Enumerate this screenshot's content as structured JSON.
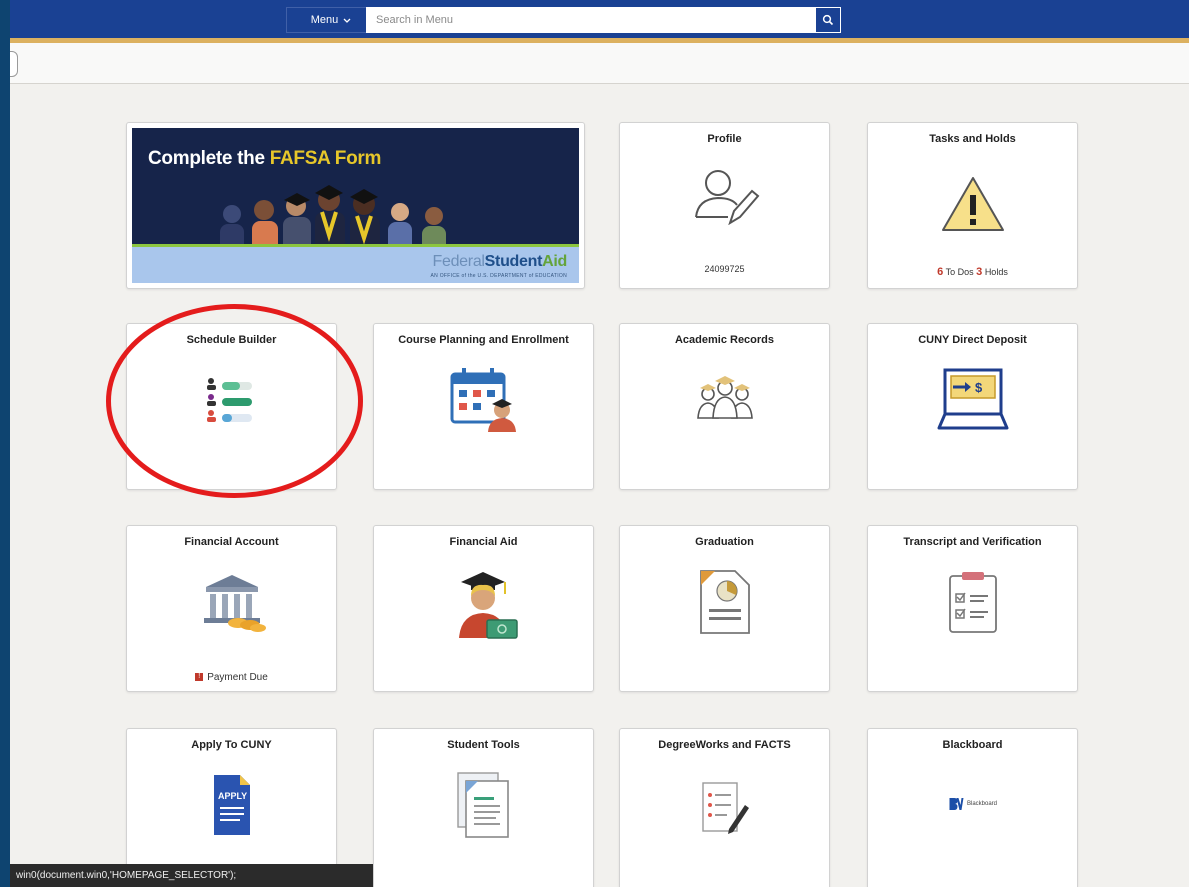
{
  "header": {
    "menu_label": "Menu",
    "search": {
      "placeholder": "Search in Menu",
      "value": ""
    }
  },
  "banner": {
    "title_prefix": "Complete the ",
    "title_highlight": "FAFSA Form",
    "logo_part1": "Federal",
    "logo_part2": "Student",
    "logo_part3": "Aid",
    "logo_sub": "AN OFFICE of the U.S. DEPARTMENT of EDUCATION"
  },
  "tiles": {
    "profile": {
      "title": "Profile",
      "footer": "24099725"
    },
    "tasks_holds": {
      "title": "Tasks and Holds",
      "todos_count": "6",
      "todos_label": "To Dos",
      "holds_count": "3",
      "holds_label": "Holds"
    },
    "schedule_builder": {
      "title": "Schedule Builder"
    },
    "course_planning": {
      "title": "Course Planning and Enrollment"
    },
    "academic_records": {
      "title": "Academic Records"
    },
    "direct_deposit": {
      "title": "CUNY Direct Deposit"
    },
    "financial_account": {
      "title": "Financial Account",
      "footer": "Payment Due"
    },
    "financial_aid": {
      "title": "Financial Aid"
    },
    "graduation": {
      "title": "Graduation"
    },
    "transcript": {
      "title": "Transcript and Verification"
    },
    "apply": {
      "title": "Apply To CUNY",
      "icon_text": "APPLY"
    },
    "student_tools": {
      "title": "Student Tools"
    },
    "degreeworks": {
      "title": "DegreeWorks and FACTS"
    },
    "blackboard": {
      "title": "Blackboard",
      "logo_text": "Blackboard"
    }
  },
  "status_bar": {
    "text": "win0(document.win0,'HOMEPAGE_SELECTOR');"
  },
  "colors": {
    "header_bg": "#1a4193",
    "header_accent": "#dcb160",
    "frame": "#0e4470",
    "highlight_circle": "#e41c1c"
  }
}
